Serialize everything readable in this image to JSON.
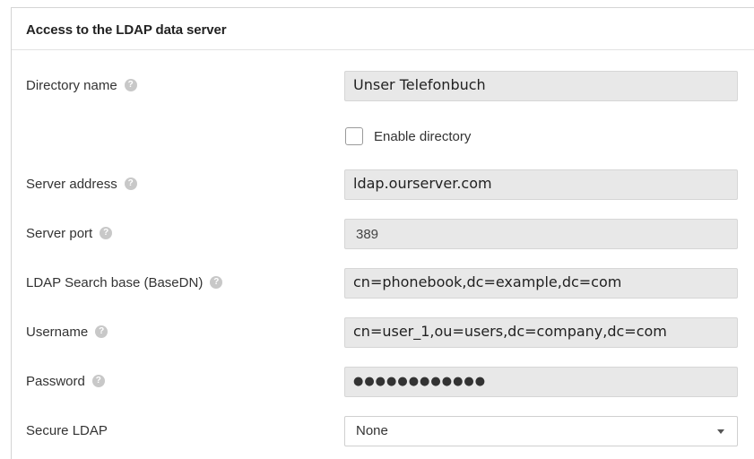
{
  "section": {
    "title": "Access to the LDAP data server"
  },
  "icons": {
    "help": "question-circle-icon",
    "dropdown": "caret-down-icon"
  },
  "help_glyph": "?",
  "fields": {
    "directory_name": {
      "label": "Directory name",
      "value": "Unser Telefonbuch"
    },
    "enable_directory": {
      "label": "Enable directory",
      "checked": false
    },
    "server_address": {
      "label": "Server address",
      "value": "ldap.ourserver.com"
    },
    "server_port": {
      "label": "Server port",
      "value": "389"
    },
    "search_base": {
      "label": "LDAP Search base (BaseDN)",
      "value": "cn=phonebook,dc=example,dc=com"
    },
    "username": {
      "label": "Username",
      "value": "cn=user_1,ou=users,dc=company,dc=com"
    },
    "password": {
      "label": "Password",
      "value": "●●●●●●●●●●●●"
    },
    "secure_ldap": {
      "label": "Secure LDAP",
      "value": "None"
    }
  },
  "colors": {
    "field_background": "#e8e8e8",
    "help_icon": "#c8c8c8",
    "border": "#d4d4d4"
  }
}
